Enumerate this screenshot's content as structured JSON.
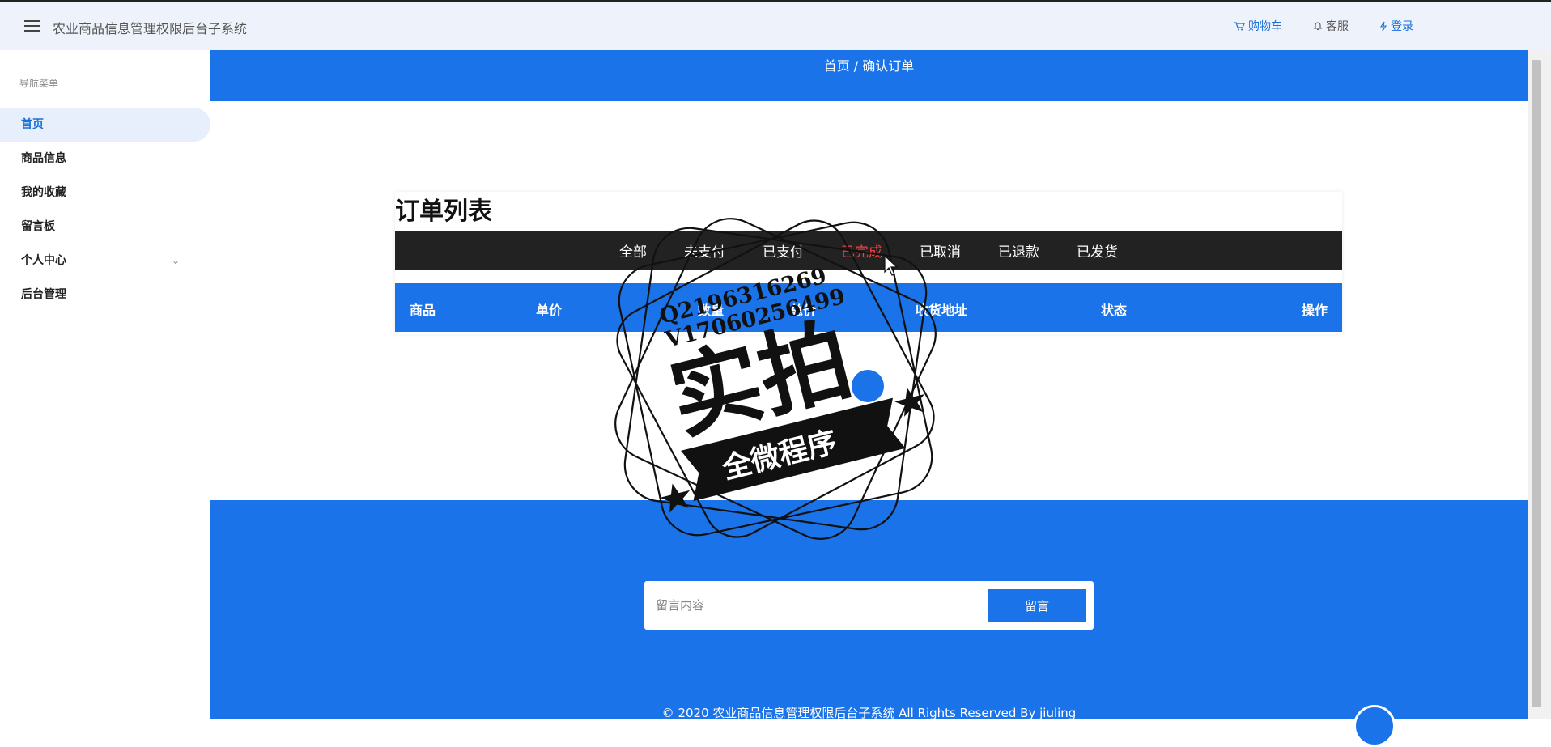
{
  "header": {
    "app_title": "农业商品信息管理权限后台子系统",
    "actions": [
      {
        "label": "购物车",
        "icon": "cart-icon"
      },
      {
        "label": "客服",
        "icon": "bell-icon"
      },
      {
        "label": "登录",
        "icon": "bolt-icon"
      }
    ]
  },
  "sidebar": {
    "title": "导航菜单",
    "items": [
      {
        "label": "首页",
        "active": true
      },
      {
        "label": "商品信息"
      },
      {
        "label": "我的收藏"
      },
      {
        "label": "留言板"
      },
      {
        "label": "个人中心",
        "has_children": true
      },
      {
        "label": "后台管理"
      }
    ]
  },
  "breadcrumb": "首页 / 确认订单",
  "orders": {
    "title": "订单列表",
    "tabs": [
      "全部",
      "未支付",
      "已支付",
      "已完成",
      "已取消",
      "已退款",
      "已发货"
    ],
    "active_tab": "已完成",
    "columns": [
      "商品",
      "单价",
      "数量",
      "总价",
      "收货地址",
      "状态",
      "操作"
    ]
  },
  "message": {
    "placeholder": "留言内容",
    "button": "留言"
  },
  "footer": {
    "copyright": "© 2020 农业商品信息管理权限后台子系统 All Rights Reserved By jiuling"
  },
  "watermark": {
    "line1": "Q2196316269",
    "line2": "V17060256499",
    "main": "实拍",
    "ribbon": "全微程序"
  },
  "colors": {
    "primary": "#1a73e8",
    "dark_bar": "#222222",
    "active_tab": "#f04040"
  }
}
